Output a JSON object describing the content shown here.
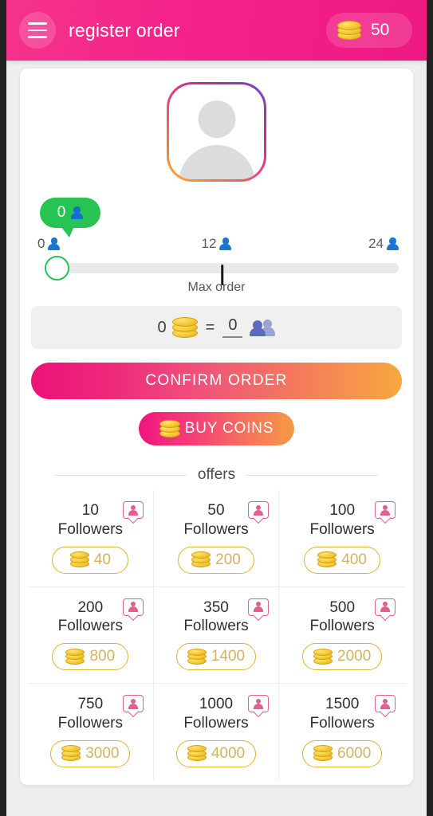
{
  "header": {
    "menu_icon": "hamburger-menu-icon",
    "title": "register order",
    "coin_icon": "coin-stack-icon",
    "coin_balance": "50"
  },
  "profile": {
    "avatar_icon": "user-avatar-placeholder-icon",
    "gradient": "#f9b43c -> #e2457f -> #6b49c8"
  },
  "slider": {
    "bubble_value": "0",
    "bubble_icon": "person-icon",
    "bubble_color": "#27c453",
    "tick_min": "0",
    "tick_mid": "12",
    "tick_max": "24",
    "tick_icon": "person-icon",
    "max_order_label": "Max order",
    "thumb_icon": "slider-thumb"
  },
  "conversion": {
    "coins_value": "0",
    "coin_icon": "coin-stack-icon",
    "equals": "=",
    "followers_value": "0",
    "followers_icon": "two-people-icon"
  },
  "actions": {
    "confirm_label": "CONFIRM ORDER",
    "buy_label": "BUY COINS",
    "buy_icon": "coin-stack-icon",
    "gradient_start": "#ed1179",
    "gradient_end": "#f8a83f"
  },
  "offers": {
    "section_title": "offers",
    "unit_label": "Followers",
    "badge_icon": "follower-badge-icon",
    "price_icon": "coin-stack-icon",
    "items": [
      {
        "count": "10",
        "price": "40"
      },
      {
        "count": "50",
        "price": "200"
      },
      {
        "count": "100",
        "price": "400"
      },
      {
        "count": "200",
        "price": "800"
      },
      {
        "count": "350",
        "price": "1400"
      },
      {
        "count": "500",
        "price": "2000"
      },
      {
        "count": "750",
        "price": "3000"
      },
      {
        "count": "1000",
        "price": "4000"
      },
      {
        "count": "1500",
        "price": "6000"
      }
    ]
  }
}
